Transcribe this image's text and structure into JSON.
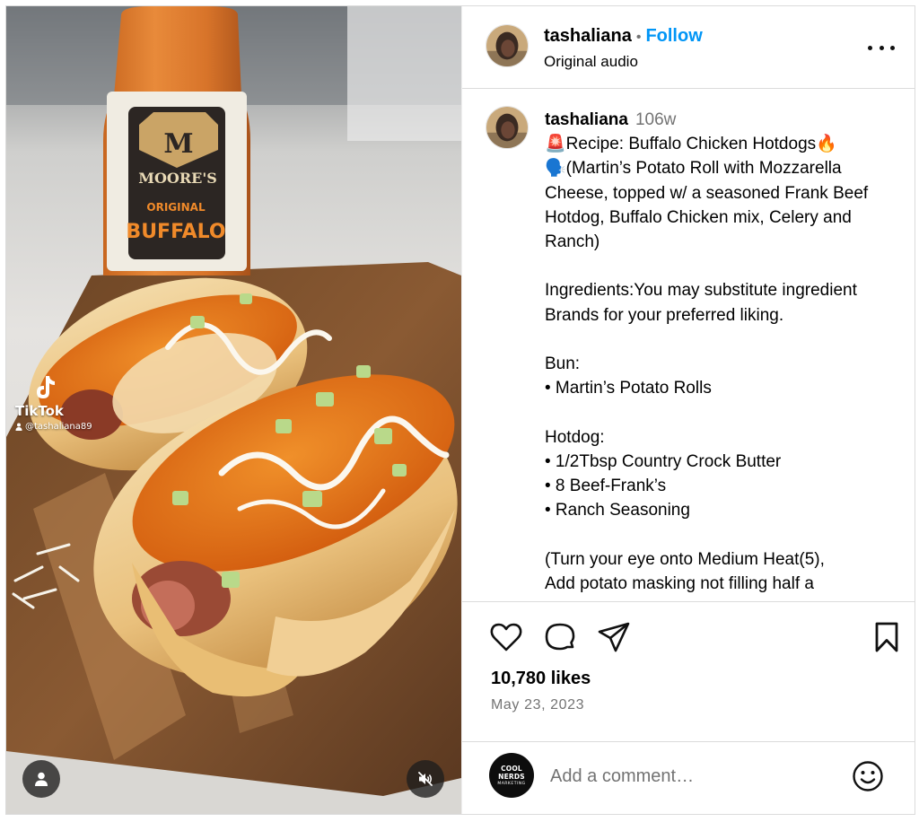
{
  "media": {
    "watermark": {
      "logo_text": "TikTok",
      "handle": "@tashaliana89"
    },
    "bottle_label": {
      "brand": "MOORE'S",
      "line1": "ORIGINAL",
      "line2": "BUFFALO"
    },
    "icons": {
      "tags": "user-tag-icon",
      "mute": "speaker-muted-icon",
      "watermark": "tiktok-icon"
    }
  },
  "header": {
    "username": "tashaliana",
    "separator": "•",
    "follow_label": "Follow",
    "audio": "Original audio",
    "icons": {
      "more": "more-options-icon"
    }
  },
  "caption": {
    "username": "tashaliana",
    "time_ago": "106w",
    "text": "🚨Recipe: Buffalo Chicken Hotdogs🔥\n🗣️(Martin’s Potato Roll with Mozzarella Cheese, topped w/ a seasoned Frank Beef Hotdog, Buffalo Chicken mix, Celery and Ranch)\n\nIngredients:You may substitute ingredient Brands for your preferred liking.\n\nBun:\n• Martin’s Potato Rolls\n\nHotdog:\n• 1/2Tbsp Country Crock Butter\n• 8 Beef-Frank’s\n• Ranch Seasoning\n\n(Turn your eye onto Medium Heat(5),\nAdd potato masking not filling half a"
  },
  "actions": {
    "icons": {
      "like": "heart-icon",
      "comment": "comment-bubble-icon",
      "share": "paper-plane-icon",
      "save": "bookmark-icon"
    },
    "likes": "10,780 likes",
    "date": "May 23, 2023"
  },
  "comment_box": {
    "avatar_line1": "COOL NERDS",
    "avatar_line2": "MARKETING",
    "placeholder": "Add a comment…",
    "icons": {
      "emoji": "emoji-smiley-icon"
    }
  }
}
